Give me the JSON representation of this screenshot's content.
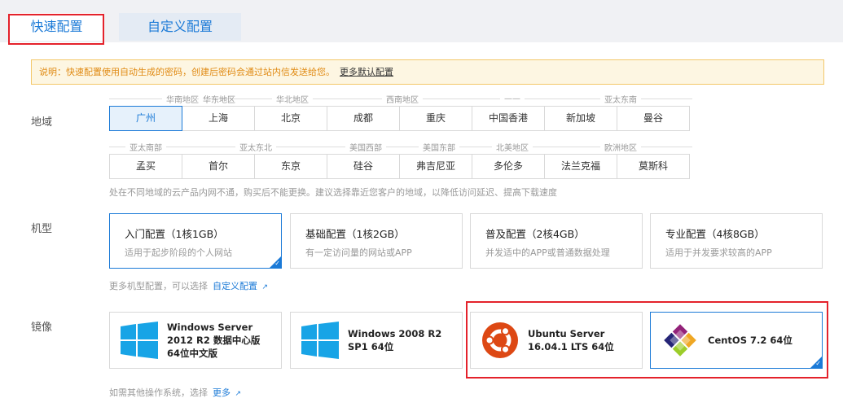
{
  "tabs": {
    "quick": "快速配置",
    "custom": "自定义配置"
  },
  "notice": {
    "text": "说明：快速配置使用自动生成的密码，创建后密码会通过站内信发送给您。",
    "link": "更多默认配置"
  },
  "region": {
    "label": "地域",
    "row1_groups": [
      "华南地区",
      "华东地区",
      "华北地区",
      "西南地区",
      "——",
      "亚太东南"
    ],
    "row1": [
      "广州",
      "上海",
      "北京",
      "成都",
      "重庆",
      "中国香港",
      "新加坡",
      "曼谷"
    ],
    "row2_groups": [
      "亚太南部",
      "亚太东北",
      "美国西部",
      "美国东部",
      "北美地区",
      "欧洲地区"
    ],
    "row2": [
      "孟买",
      "首尔",
      "东京",
      "硅谷",
      "弗吉尼亚",
      "多伦多",
      "法兰克福",
      "莫斯科"
    ],
    "selected": "广州",
    "hint": "处在不同地域的云产品内网不通，购买后不能更换。建议选择靠近您客户的地域，以降低访问延迟、提高下载速度"
  },
  "instance": {
    "label": "机型",
    "cards": [
      {
        "title": "入门配置（1核1GB）",
        "desc": "适用于起步阶段的个人网站"
      },
      {
        "title": "基础配置（1核2GB）",
        "desc": "有一定访问量的网站或APP"
      },
      {
        "title": "普及配置（2核4GB）",
        "desc": "并发适中的APP或普通数据处理"
      },
      {
        "title": "专业配置（4核8GB）",
        "desc": "适用于并发要求较高的APP"
      }
    ],
    "selected": "入门配置（1核1GB）",
    "hint": "更多机型配置，可以选择",
    "hint_link": "自定义配置"
  },
  "image": {
    "label": "镜像",
    "cards": [
      {
        "name": "Windows Server 2012 R2 数据中心版 64位中文版",
        "icon": "windows-icon"
      },
      {
        "name": "Windows 2008 R2 SP1 64位",
        "icon": "windows-icon"
      },
      {
        "name": "Ubuntu Server 16.04.1 LTS 64位",
        "icon": "ubuntu-icon"
      },
      {
        "name": "CentOS 7.2 64位",
        "icon": "centos-icon"
      }
    ],
    "selected": "CentOS 7.2 64位",
    "hint": "如需其他操作系统，选择",
    "hint_link": "更多"
  },
  "colors": {
    "accent": "#1b7ad7",
    "highlight_box": "#e4222b",
    "notice_bg": "#fdf6e2",
    "notice_text": "#e08a13"
  }
}
